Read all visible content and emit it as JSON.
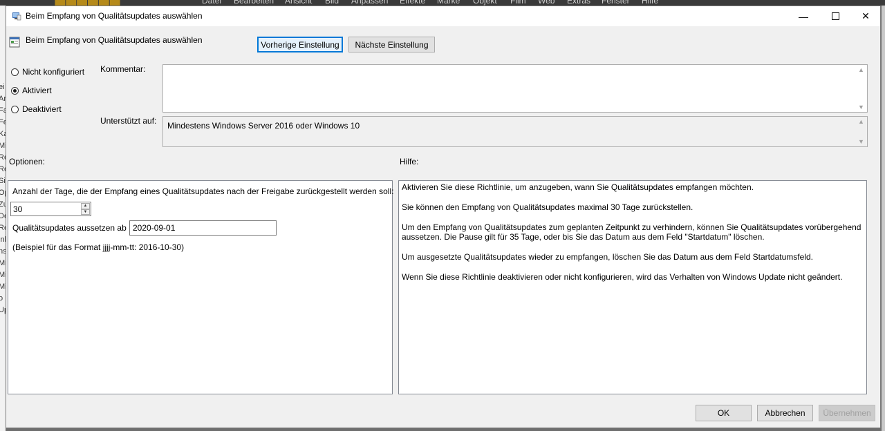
{
  "background": {
    "menu_items": [
      "Datei",
      "Bearbeiten",
      "Ansicht",
      "Bild",
      "Anpassen",
      "Effekte",
      "Marke",
      "Objekt",
      "Film",
      "Web",
      "Extras",
      "Fenster",
      "Hilfe"
    ],
    "left_fragments": [
      "ei",
      "Ar",
      "Fa",
      "Fe",
      "Ka",
      "Mi",
      "Re",
      "Re",
      "Si",
      "Op",
      "Zu",
      "De",
      "Re",
      "inl",
      "ns",
      "Mi",
      "Mi",
      "Mi",
      "o",
      "Up"
    ]
  },
  "dialog": {
    "title": "Beim Empfang von Qualitätsupdates auswählen",
    "window_controls": {
      "minimize": "—",
      "close": "✕"
    },
    "header_title": "Beim Empfang von Qualitätsupdates auswählen",
    "nav": {
      "prev": "Vorherige Einstellung",
      "next": "Nächste Einstellung"
    },
    "radios": [
      {
        "label": "Nicht konfiguriert",
        "checked": false
      },
      {
        "label": "Aktiviert",
        "checked": true
      },
      {
        "label": "Deaktiviert",
        "checked": false
      }
    ],
    "comment_label": "Kommentar:",
    "comment_value": "",
    "supported_label": "Unterstützt auf:",
    "supported_value": "Mindestens Windows Server 2016 oder Windows 10",
    "options_label": "Optionen:",
    "help_label": "Hilfe:",
    "options": {
      "days_prompt": "Anzahl der Tage, die der Empfang eines Qualitätsupdates nach der Freigabe zurückgestellt werden soll:",
      "days_value": "30",
      "pause_label": "Qualitätsupdates aussetzen ab",
      "pause_value": "2020-09-01",
      "format_hint": "(Beispiel für das Format jjjj-mm-tt: 2016-10-30)"
    },
    "help": [
      "Aktivieren Sie diese Richtlinie, um anzugeben, wann Sie Qualitätsupdates empfangen möchten.",
      "Sie können den Empfang von Qualitätsupdates maximal 30 Tage zurückstellen.",
      "Um den Empfang von Qualitätsupdates zum geplanten Zeitpunkt zu verhindern, können Sie Qualitätsupdates vorübergehend aussetzen. Die Pause gilt für 35 Tage, oder bis Sie das Datum aus dem Feld \"Startdatum\" löschen.",
      "Um ausgesetzte Qualitätsupdates wieder zu empfangen, löschen Sie das Datum aus dem Feld Startdatumsfeld.",
      "Wenn Sie diese Richtlinie deaktivieren oder nicht konfigurieren, wird das Verhalten von Windows Update nicht geändert."
    ],
    "buttons": {
      "ok": "OK",
      "cancel": "Abbrechen",
      "apply": "Übernehmen"
    }
  },
  "colors": {
    "accent": "#0078d7",
    "dialog_bg": "#f0f0f0"
  }
}
